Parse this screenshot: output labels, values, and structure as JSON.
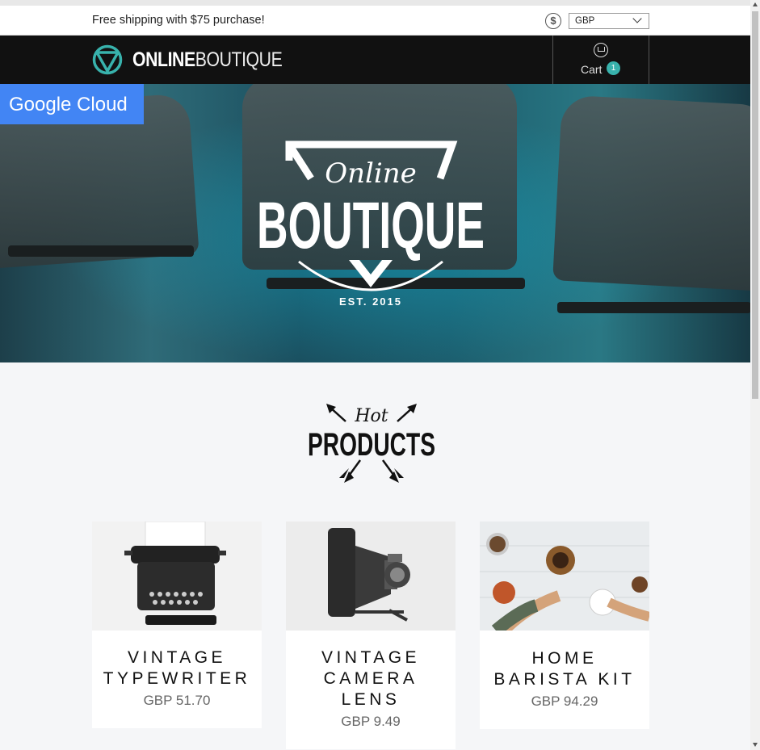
{
  "announcement": {
    "text": "Free shipping with $75 purchase!"
  },
  "currency": {
    "icon": "dollar-circle-icon",
    "selected": "GBP"
  },
  "navbar": {
    "logo_bold": "ONLINE",
    "logo_thin": "BOUTIQUE",
    "cart_label": "Cart",
    "cart_count": "1"
  },
  "gcloud_badge": {
    "label": "Google Cloud"
  },
  "hero": {
    "line1": "Online",
    "line2": "BOUTIQUE",
    "est": "EST. 2015"
  },
  "hot_products": {
    "line1": "Hot",
    "line2": "PRODUCTS"
  },
  "products": [
    {
      "name_line1": "VINTAGE",
      "name_line2": "TYPEWRITER",
      "name_line3": "",
      "price": "GBP 51.70"
    },
    {
      "name_line1": "VINTAGE",
      "name_line2": "CAMERA",
      "name_line3": "LENS",
      "price": "GBP 9.49"
    },
    {
      "name_line1": "HOME",
      "name_line2": "BARISTA KIT",
      "name_line3": "",
      "price": "GBP 94.29"
    }
  ],
  "colors": {
    "accent": "#38b2ac",
    "navbar": "#111111",
    "gcloud": "#4285f4"
  }
}
